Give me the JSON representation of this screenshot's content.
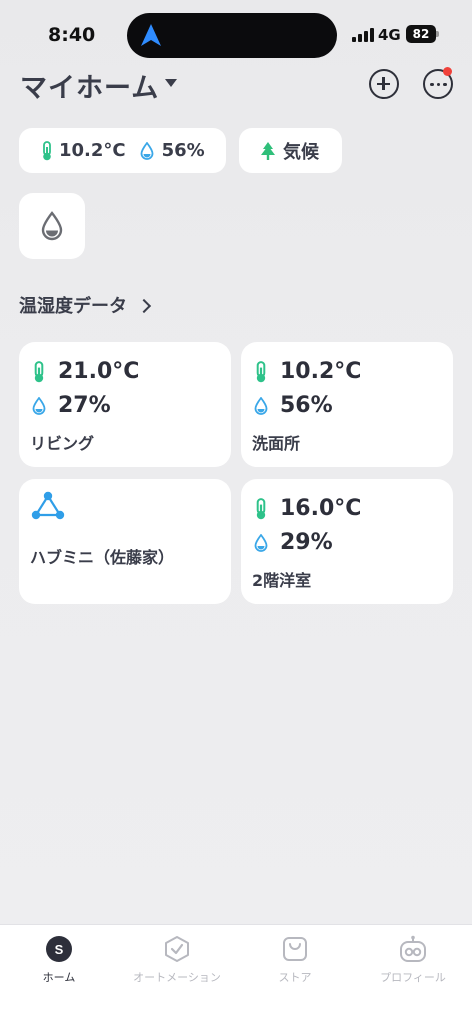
{
  "status_bar": {
    "time": "8:40",
    "network": "4G",
    "battery": "82"
  },
  "header": {
    "title": "マイホーム"
  },
  "chips": {
    "weather": {
      "temperature": "10.2°C",
      "humidity": "56%"
    },
    "climate_label": "気候"
  },
  "section": {
    "title": "温湿度データ"
  },
  "devices": [
    {
      "temperature": "21.0°C",
      "humidity": "27%",
      "name": "リビング"
    },
    {
      "temperature": "10.2°C",
      "humidity": "56%",
      "name": "洗面所"
    },
    {
      "name": "ハブミニ（佐藤家）"
    },
    {
      "temperature": "16.0°C",
      "humidity": "29%",
      "name": "2階洋室"
    }
  ],
  "tabs": [
    {
      "label": "ホーム",
      "icon": "s-logo-icon",
      "active": true
    },
    {
      "label": "オートメーション",
      "icon": "shield-check-icon"
    },
    {
      "label": "ストア",
      "icon": "bag-icon"
    },
    {
      "label": "プロフィール",
      "icon": "robot-icon"
    }
  ],
  "colors": {
    "thermo": "#2ec28a",
    "droplet": "#3aa7e8",
    "hub": "#2f9ee8",
    "tree": "#2fbf7a",
    "accent_dot": "#f0413a"
  }
}
